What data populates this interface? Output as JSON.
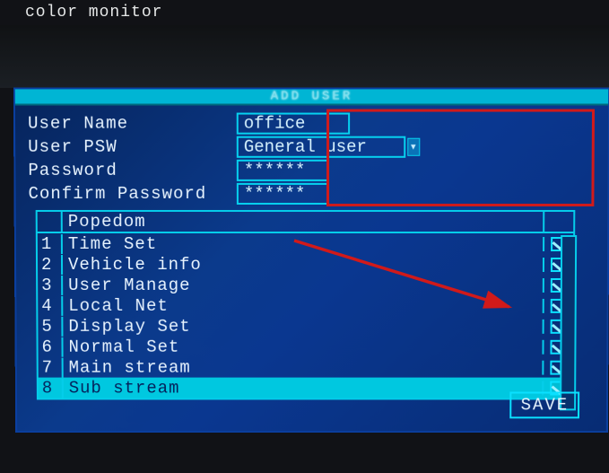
{
  "monitor_label": "color monitor",
  "dialog_title": "ADD USER",
  "form": {
    "username_label": "User Name",
    "username_value": "office",
    "usertype_label": "User PSW",
    "usertype_value": "General user",
    "password_label": "Password",
    "password_value": "******",
    "confirm_label": "Confirm Password",
    "confirm_value": "******"
  },
  "popedom_header": "Popedom",
  "popedom": [
    {
      "n": "1",
      "name": "Time Set",
      "checked": true
    },
    {
      "n": "2",
      "name": "Vehicle info",
      "checked": true
    },
    {
      "n": "3",
      "name": "User Manage",
      "checked": true
    },
    {
      "n": "4",
      "name": "Local Net",
      "checked": true
    },
    {
      "n": "5",
      "name": "Display Set",
      "checked": true
    },
    {
      "n": "6",
      "name": "Normal Set",
      "checked": true
    },
    {
      "n": "7",
      "name": "Main stream",
      "checked": true
    },
    {
      "n": "8",
      "name": "Sub stream",
      "checked": true
    }
  ],
  "selected_index": 7,
  "save_label": "SAVE"
}
